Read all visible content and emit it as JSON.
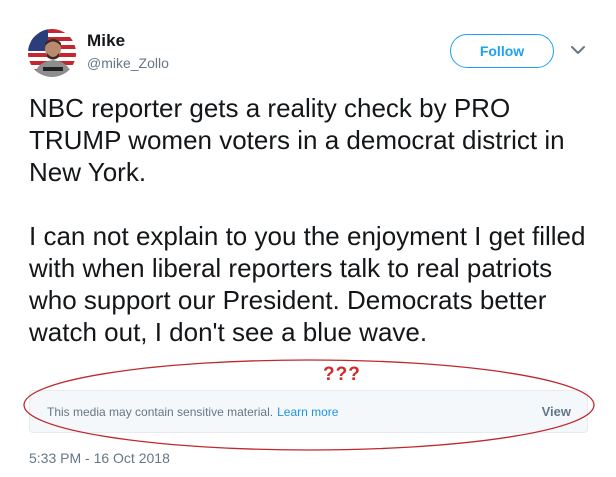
{
  "author": {
    "display_name": "Mike",
    "handle": "@mike_Zollo",
    "avatar_icon": "profile-photo-flag"
  },
  "actions": {
    "follow_label": "Follow",
    "more_icon": "chevron-down-icon"
  },
  "tweet": {
    "paragraphs": [
      "NBC reporter gets a reality check by PRO TRUMP women voters in a democrat district in New York.",
      "I can not explain to you the enjoyment I get filled with when liberal reporters talk to real patriots who support our President. Democrats better watch out, I don't see a blue wave."
    ],
    "timestamp": "5:33 PM - 16 Oct 2018"
  },
  "media_notice": {
    "message": "This media may contain sensitive material.",
    "learn_more": "Learn more",
    "view_label": "View"
  },
  "annotation": {
    "text": "???",
    "color": "#d12a2a"
  },
  "colors": {
    "accent": "#1da1f2",
    "link": "#1b95e0",
    "secondary_text": "#657786",
    "primary_text": "#14171a"
  }
}
